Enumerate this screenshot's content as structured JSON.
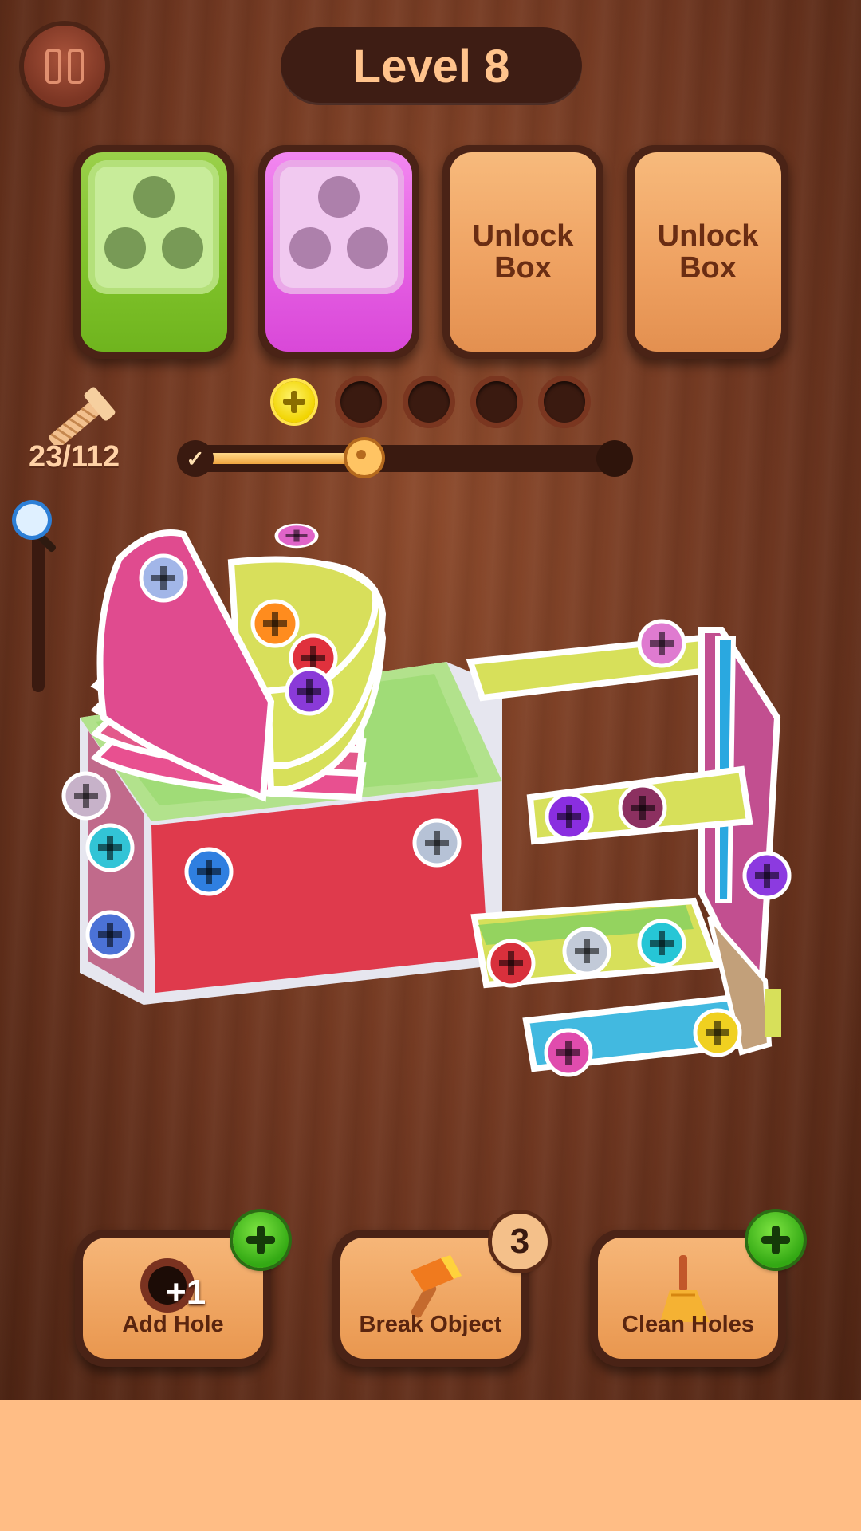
{
  "header": {
    "level_label": "Level 8"
  },
  "boxes": [
    {
      "type": "color",
      "color": "green"
    },
    {
      "type": "color",
      "color": "pink"
    },
    {
      "type": "locked",
      "label": "Unlock Box"
    },
    {
      "type": "locked",
      "label": "Unlock Box"
    }
  ],
  "screws": {
    "count_label": "23/112"
  },
  "hole_slots": {
    "total": 5,
    "filled": 1,
    "filled_color": "#ffe44c"
  },
  "progress": {
    "fraction": 0.41
  },
  "tools": {
    "add_hole": {
      "label": "Add Hole",
      "bonus": "+1"
    },
    "break_object": {
      "label": "Break Object",
      "uses": "3"
    },
    "clean_holes": {
      "label": "Clean Holes"
    }
  },
  "colors": {
    "accent_text": "#ffc38c",
    "green_box": "#7fc22a",
    "pink_box": "#e45de2",
    "locked_box": "#eea060",
    "bottom_band": "#ffbd85"
  }
}
